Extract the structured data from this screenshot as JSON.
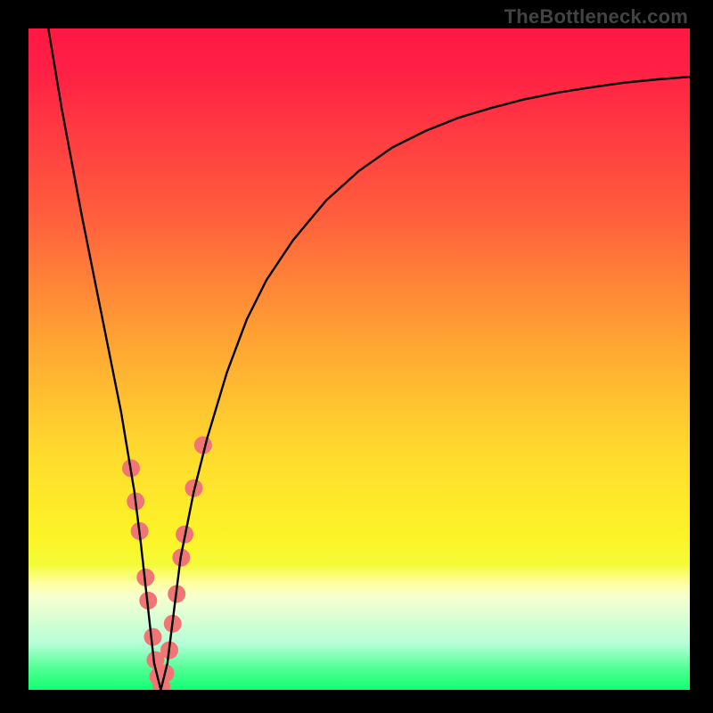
{
  "watermark": "TheBottleneck.com",
  "chart_data": {
    "type": "line",
    "title": "",
    "xlabel": "",
    "ylabel": "",
    "xlim": [
      0,
      100
    ],
    "ylim": [
      0,
      100
    ],
    "grid": false,
    "legend": false,
    "gradient_stops": [
      {
        "offset": 0.0,
        "color": "#ff1944"
      },
      {
        "offset": 0.06,
        "color": "#ff1f45"
      },
      {
        "offset": 0.28,
        "color": "#ff5d3d"
      },
      {
        "offset": 0.47,
        "color": "#ffa333"
      },
      {
        "offset": 0.64,
        "color": "#ffda2e"
      },
      {
        "offset": 0.77,
        "color": "#fcf427"
      },
      {
        "offset": 0.81,
        "color": "#f4fa36"
      },
      {
        "offset": 0.84,
        "color": "#ffffa6"
      },
      {
        "offset": 0.86,
        "color": "#f6ffd0"
      },
      {
        "offset": 0.93,
        "color": "#b5ffd7"
      },
      {
        "offset": 0.97,
        "color": "#4cff91"
      },
      {
        "offset": 1.0,
        "color": "#12ff71"
      }
    ],
    "series": [
      {
        "name": "bottleneck-curve",
        "color": "#000000",
        "x": [
          3,
          5,
          8,
          10,
          12,
          14,
          15,
          16,
          17,
          18,
          19,
          20,
          21,
          22,
          23,
          25,
          27,
          30,
          33,
          36,
          40,
          45,
          50,
          55,
          60,
          65,
          70,
          75,
          80,
          85,
          90,
          95,
          100
        ],
        "values": [
          100,
          88,
          72,
          62,
          52,
          42,
          36,
          30,
          22,
          13,
          4,
          0,
          4,
          12,
          20,
          30,
          38,
          48,
          56,
          62,
          68,
          74,
          78.5,
          82,
          84.5,
          86.5,
          88,
          89.3,
          90.3,
          91.1,
          91.8,
          92.3,
          92.7
        ]
      }
    ],
    "highlight_points": {
      "name": "sample-dots",
      "color": "#f07676",
      "radius": 10,
      "points": [
        {
          "x": 15.5,
          "y": 33.5
        },
        {
          "x": 16.2,
          "y": 28.5
        },
        {
          "x": 16.8,
          "y": 24.0
        },
        {
          "x": 17.7,
          "y": 17.0
        },
        {
          "x": 18.1,
          "y": 13.5
        },
        {
          "x": 18.8,
          "y": 8.0
        },
        {
          "x": 19.2,
          "y": 4.5
        },
        {
          "x": 19.6,
          "y": 2.0
        },
        {
          "x": 20.1,
          "y": 0.5
        },
        {
          "x": 20.7,
          "y": 2.5
        },
        {
          "x": 21.3,
          "y": 6.0
        },
        {
          "x": 21.8,
          "y": 10.0
        },
        {
          "x": 22.4,
          "y": 14.5
        },
        {
          "x": 23.1,
          "y": 20.0
        },
        {
          "x": 23.6,
          "y": 23.5
        },
        {
          "x": 25.0,
          "y": 30.5
        },
        {
          "x": 26.4,
          "y": 37.0
        }
      ]
    }
  }
}
